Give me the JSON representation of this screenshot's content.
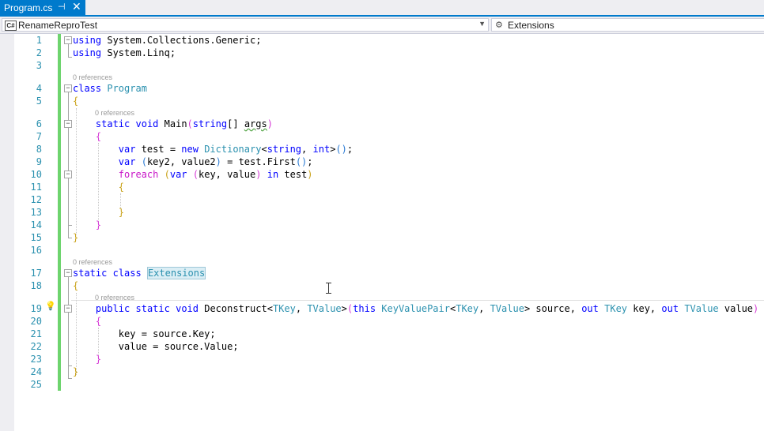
{
  "tab": {
    "title": "Program.cs",
    "pin_glyph": "⊣",
    "close_glyph": "✕"
  },
  "nav": {
    "left": {
      "icon": "C#",
      "label": "RenameReproTest"
    },
    "right": {
      "label": "Extensions"
    }
  },
  "codelens_text": "0 references",
  "lines": [
    {
      "n": "1"
    },
    {
      "n": "2"
    },
    {
      "n": "3"
    },
    {
      "n": "4"
    },
    {
      "n": "5"
    },
    {
      "n": "6"
    },
    {
      "n": "7"
    },
    {
      "n": "8"
    },
    {
      "n": "9"
    },
    {
      "n": "10"
    },
    {
      "n": "11"
    },
    {
      "n": "12"
    },
    {
      "n": "13"
    },
    {
      "n": "14"
    },
    {
      "n": "15"
    },
    {
      "n": "16"
    },
    {
      "n": "17"
    },
    {
      "n": "18"
    },
    {
      "n": "19"
    },
    {
      "n": "20"
    },
    {
      "n": "21"
    },
    {
      "n": "22"
    },
    {
      "n": "23"
    },
    {
      "n": "24"
    },
    {
      "n": "25"
    }
  ],
  "tokens": {
    "using": "using",
    "ns1": " System.Collections.Generic;",
    "ns2": " System.Linq;",
    "class": "class",
    "program": "Program",
    "static": "static",
    "void": "void",
    "main": "Main",
    "string": "string",
    "argsdecl": "[] ",
    "args": "args",
    "var": "var",
    "new": "new",
    "dictionary": "Dictionary",
    "int": "int",
    "test": " test = ",
    "first": " = test.First",
    "foreach": "foreach",
    "in": "in",
    "key2value2": "key2, value2",
    "keyvalue": "key, value",
    "testend": " test",
    "extensions": "Extensions",
    "public": "public",
    "deconstruct": "Deconstruct",
    "tkey": "TKey",
    "tvalue": "TValue",
    "this": "this",
    "kvp": "KeyValuePair",
    "out": "out",
    "source": " source, ",
    "key": " key, ",
    "value": " value",
    "line21": "key = source.Key;",
    "line22": "value = source.Value;"
  }
}
